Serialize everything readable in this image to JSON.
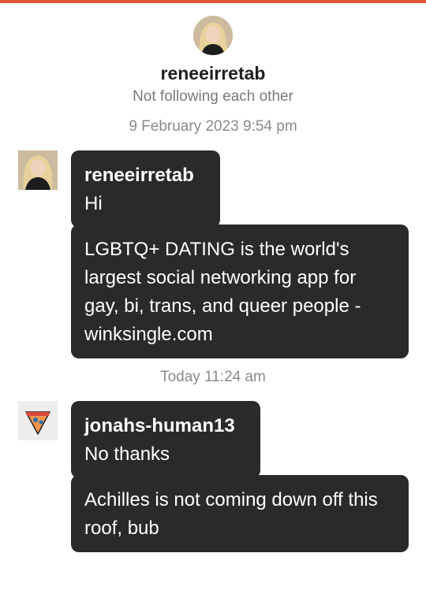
{
  "header": {
    "username": "reneeirretab",
    "status": "Not following each other"
  },
  "conversation": [
    {
      "timestamp": "9 February 2023 9:54 pm",
      "sender": "reneeirretab",
      "messages": [
        "Hi",
        "LGBTQ+ DATING is the world's largest social networking app for gay, bi, trans, and queer people - winksingle.com"
      ]
    },
    {
      "timestamp": "Today 11:24 am",
      "sender": "jonahs-human13",
      "messages": [
        "No thanks",
        "Achilles is not coming down off this roof, bub"
      ]
    }
  ],
  "colors": {
    "accent": "#e2553b",
    "bubble": "#2a2a2a",
    "muted_text": "#7a7a7a"
  },
  "icons": {
    "avatar_renee": "profile-photo-icon",
    "avatar_jonah": "pizza-slice-icon"
  }
}
